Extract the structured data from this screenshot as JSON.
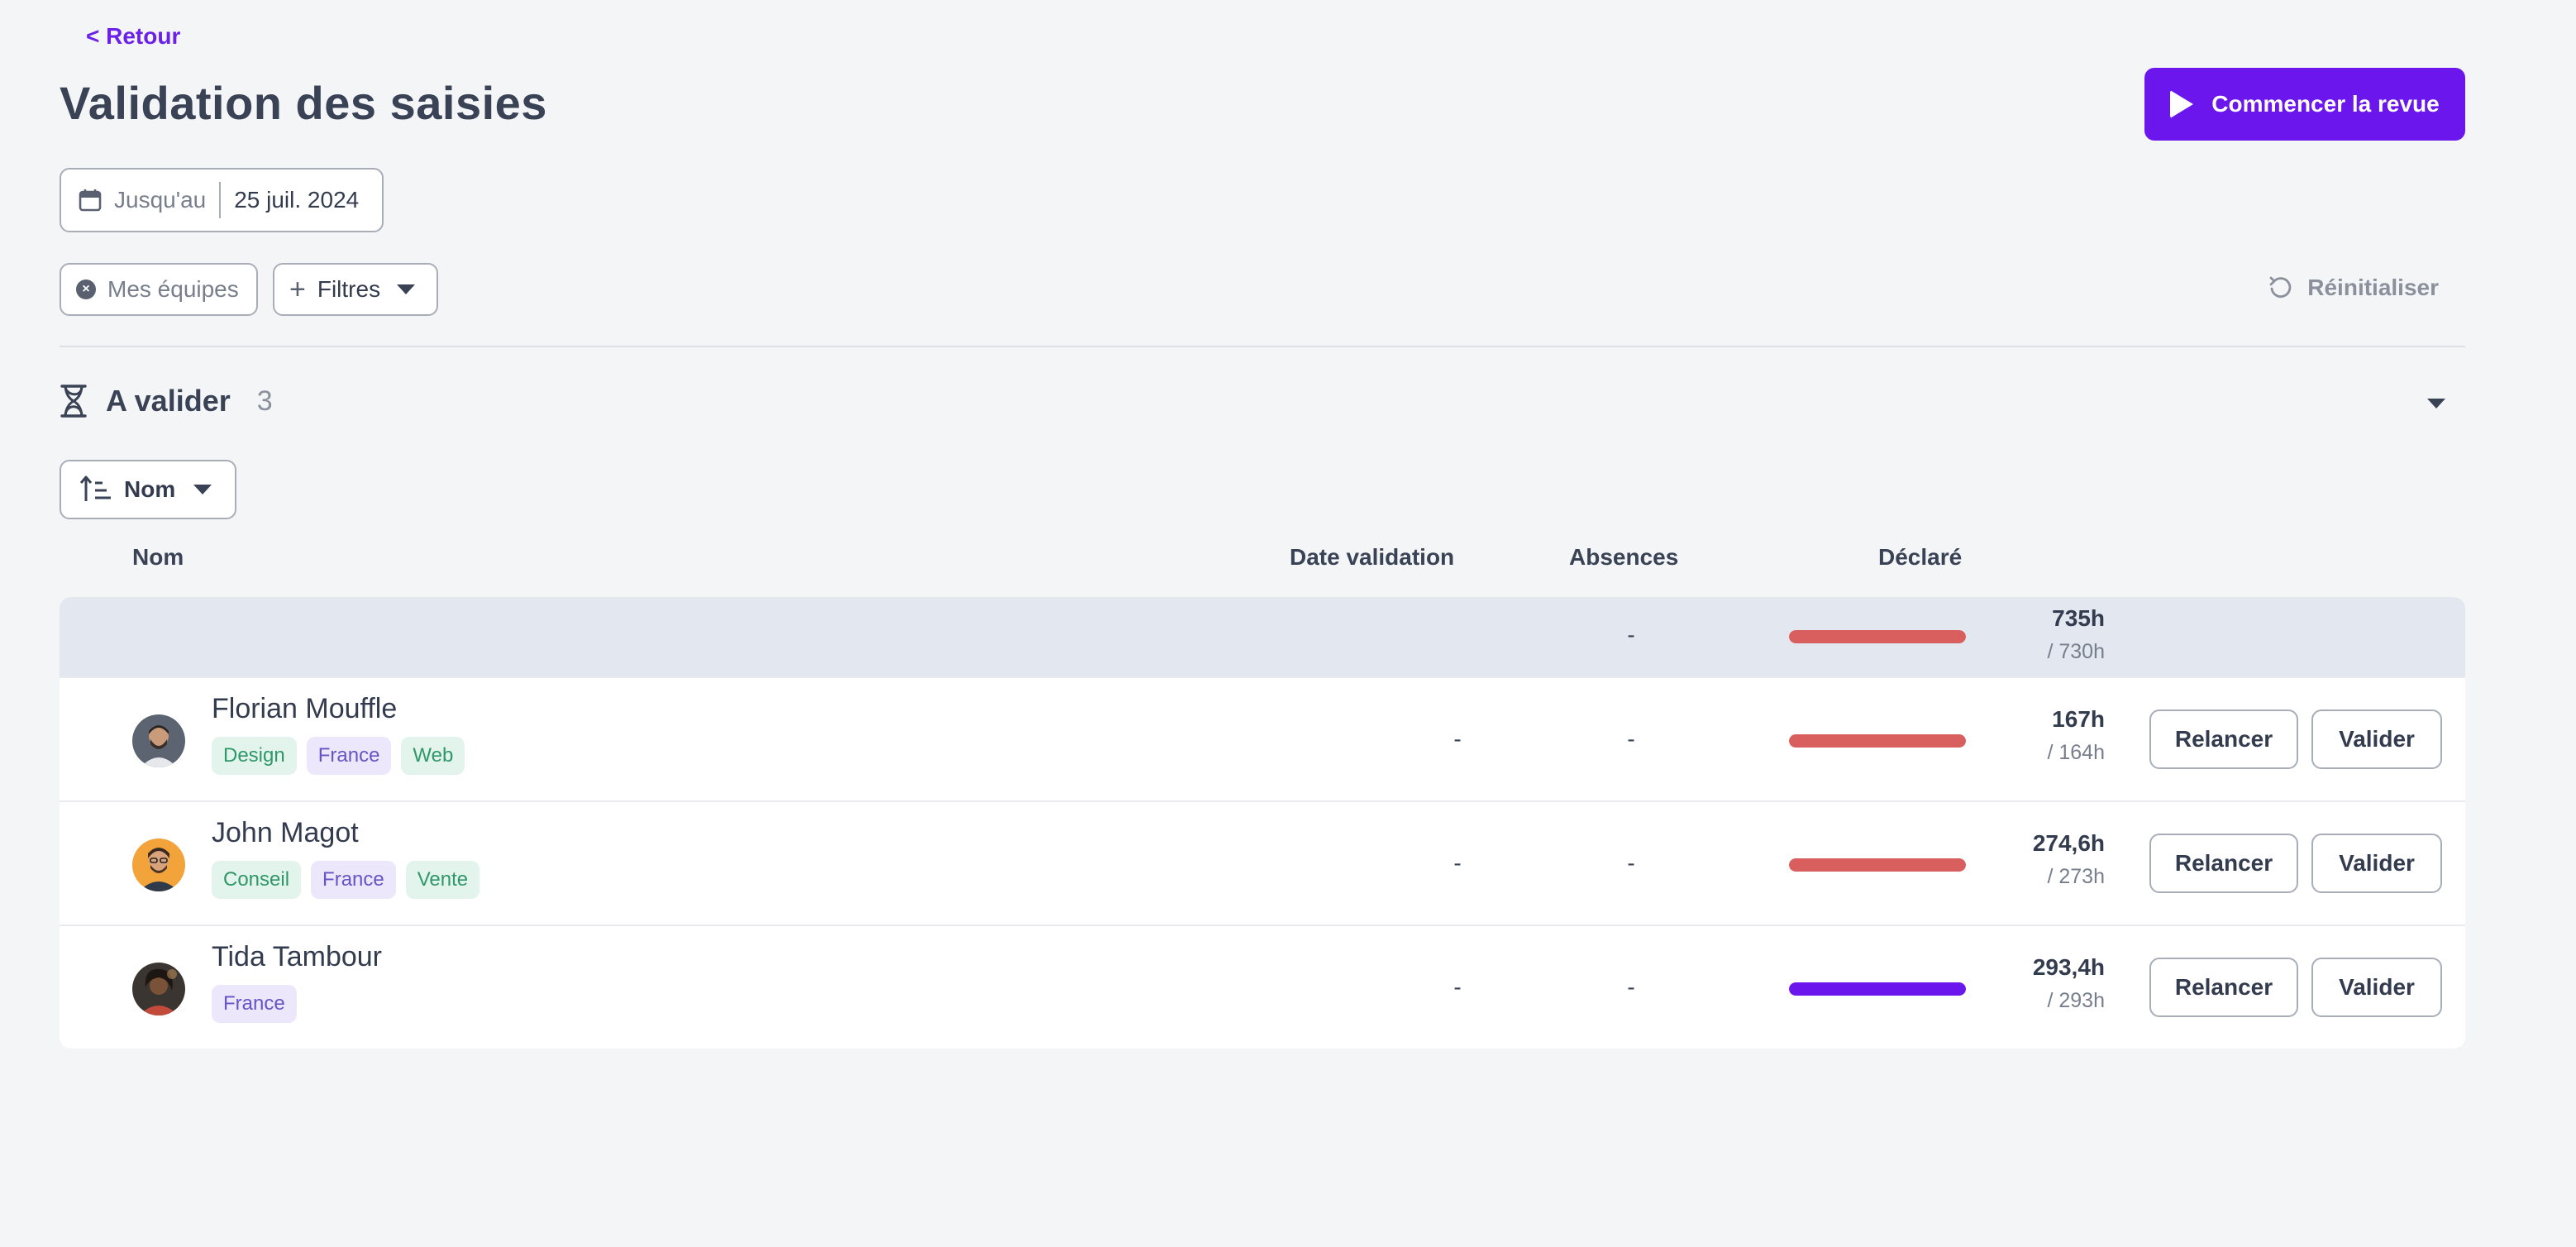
{
  "header": {
    "back_label": "< Retour",
    "title": "Validation des saisies",
    "start_review_label": "Commencer la revue"
  },
  "date_filter": {
    "label": "Jusqu'au",
    "value": "25 juil. 2024"
  },
  "filters": {
    "teams_chip": "Mes équipes",
    "filters_label": "Filtres",
    "reset_label": "Réinitialiser"
  },
  "section": {
    "title": "A valider",
    "count": "3"
  },
  "sort": {
    "label": "Nom"
  },
  "columns": {
    "name": "Nom",
    "validation_date": "Date validation",
    "absences": "Absences",
    "declared": "Déclaré"
  },
  "total": {
    "absences": "-",
    "declared": "735h",
    "expected": "/ 730h",
    "progress": 1.0,
    "bar_color": "#d95f5f"
  },
  "rows": [
    {
      "name": "Florian Mouffle",
      "tags": [
        {
          "label": "Design",
          "kind": "green"
        },
        {
          "label": "France",
          "kind": "purple"
        },
        {
          "label": "Web",
          "kind": "green"
        }
      ],
      "validation_date": "-",
      "absences": "-",
      "declared": "167h",
      "expected": "/ 164h",
      "progress": 1.0,
      "bar_color": "#d95f5f",
      "remind_label": "Relancer",
      "validate_label": "Valider"
    },
    {
      "name": "John Magot",
      "tags": [
        {
          "label": "Conseil",
          "kind": "green"
        },
        {
          "label": "France",
          "kind": "purple"
        },
        {
          "label": "Vente",
          "kind": "green"
        }
      ],
      "validation_date": "-",
      "absences": "-",
      "declared": "274,6h",
      "expected": "/ 273h",
      "progress": 1.0,
      "bar_color": "#d95f5f",
      "remind_label": "Relancer",
      "validate_label": "Valider"
    },
    {
      "name": "Tida Tambour",
      "tags": [
        {
          "label": "France",
          "kind": "purple"
        }
      ],
      "validation_date": "-",
      "absences": "-",
      "declared": "293,4h",
      "expected": "/ 293h",
      "progress": 1.0,
      "bar_color": "#6b16ec",
      "remind_label": "Relancer",
      "validate_label": "Valider"
    }
  ],
  "colors": {
    "accent": "#6b16ec",
    "over_target": "#d95f5f"
  }
}
